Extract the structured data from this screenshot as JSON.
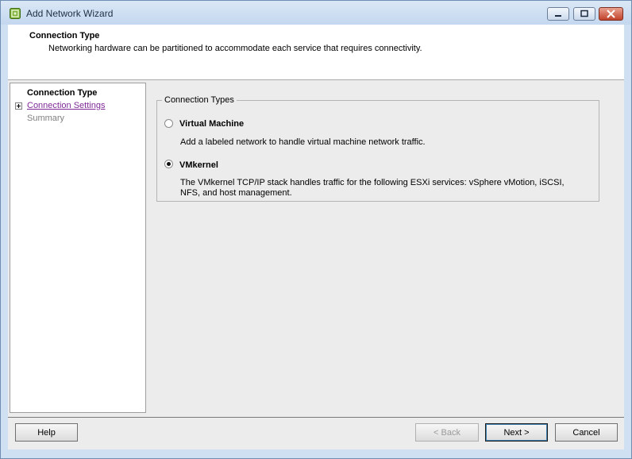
{
  "window": {
    "title": "Add Network Wizard"
  },
  "header": {
    "title": "Connection Type",
    "description": "Networking hardware can be partitioned to accommodate each service that requires connectivity."
  },
  "nav": {
    "items": [
      {
        "label": "Connection Type",
        "state": "current"
      },
      {
        "label": "Connection Settings",
        "state": "link"
      },
      {
        "label": "Summary",
        "state": "inactive"
      }
    ]
  },
  "connection_types": {
    "legend": "Connection Types",
    "options": [
      {
        "label": "Virtual Machine",
        "description": "Add a labeled network to handle virtual machine network traffic.",
        "selected": false
      },
      {
        "label": "VMkernel",
        "description": "The VMkernel TCP/IP stack handles traffic for the following ESXi services: vSphere vMotion, iSCSI, NFS, and host management.",
        "selected": true
      }
    ]
  },
  "footer": {
    "help_label": "Help",
    "back_label": "< Back",
    "next_label": "Next >",
    "cancel_label": "Cancel"
  },
  "colors": {
    "window_frame": "#cfe0f2",
    "link": "#7e2a96",
    "close_button": "#c0412a"
  }
}
